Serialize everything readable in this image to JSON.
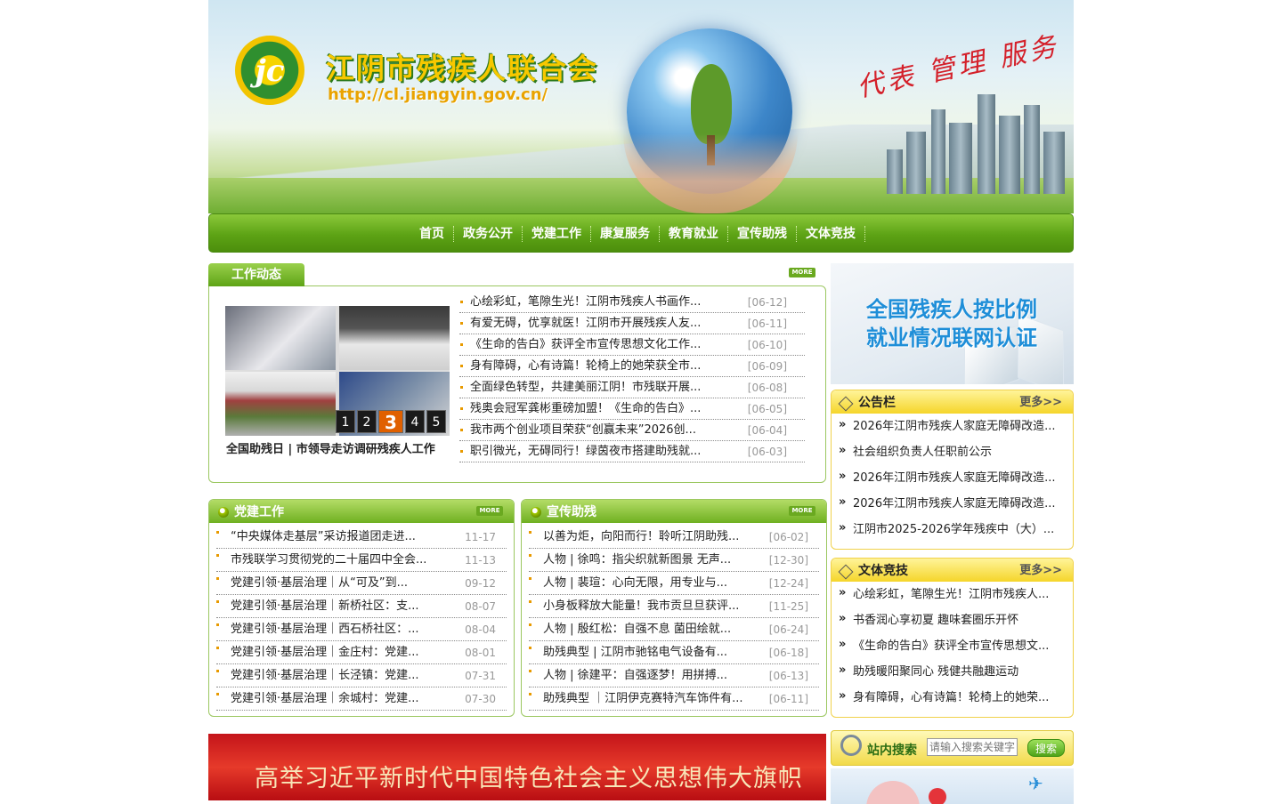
{
  "header": {
    "logo_text": "jc",
    "site_title": "江阴市残疾人联合会",
    "site_url": "http://cl.jiangyin.gov.cn/",
    "slogan": "代表 管理 服务"
  },
  "nav": {
    "items": [
      "首页",
      "政务公开",
      "党建工作",
      "康复服务",
      "教育就业",
      "宣传助残",
      "文体竞技"
    ]
  },
  "work": {
    "title": "工作动态",
    "more_label": "MORE",
    "photo_caption": "全国助残日 | 市领导走访调研残疾人工作",
    "pager": [
      "1",
      "2",
      "3",
      "4",
      "5"
    ],
    "pager_active": "3",
    "news": [
      {
        "title": "心绘彩虹，笔隙生光！江阴市残疾人书画作...",
        "date": "[06-12]"
      },
      {
        "title": "有爱无碍，优享就医！江阴市开展残疾人友...",
        "date": "[06-11]"
      },
      {
        "title": "《生命的告白》获评全市宣传思想文化工作...",
        "date": "[06-10]"
      },
      {
        "title": "身有障碍，心有诗篇！轮椅上的她荣获全市...",
        "date": "[06-09]"
      },
      {
        "title": "全面绿色转型，共建美丽江阴！市残联开展...",
        "date": "[06-08]"
      },
      {
        "title": "残奥会冠军龚彬重磅加盟！《生命的告白》...",
        "date": "[06-05]"
      },
      {
        "title": "我市两个创业项目荣获“创赢未来”2026创...",
        "date": "[06-04]"
      },
      {
        "title": "职引微光，无碍同行！绿茵夜市搭建助残就...",
        "date": "[06-03]"
      }
    ]
  },
  "party": {
    "title": "党建工作",
    "more_label": "MORE",
    "items": [
      {
        "title": "“中央媒体走基层”采访报道团走进...",
        "date": "11-17"
      },
      {
        "title": "市残联学习贯彻党的二十届四中全会...",
        "date": "11-13"
      },
      {
        "title": "党建引领·基层治理｜从“可及”到...",
        "date": "09-12"
      },
      {
        "title": "党建引领·基层治理｜新桥社区：支...",
        "date": "08-07"
      },
      {
        "title": "党建引领·基层治理｜西石桥社区：...",
        "date": "08-04"
      },
      {
        "title": "党建引领·基层治理｜金庄村：党建...",
        "date": "08-01"
      },
      {
        "title": "党建引领·基层治理｜长泾镇：党建...",
        "date": "07-31"
      },
      {
        "title": "党建引领·基层治理｜余城村：党建...",
        "date": "07-30"
      }
    ]
  },
  "publicity": {
    "title": "宣传助残",
    "more_label": "MORE",
    "items": [
      {
        "title": "以善为炬，向阳而行！聆听江阴助残...",
        "date": "[06-02]"
      },
      {
        "title": "人物 | 徐鸣：指尖织就新图景 无声...",
        "date": "[12-30]"
      },
      {
        "title": "人物 | 裴瑄：心向无限，用专业与...",
        "date": "[12-24]"
      },
      {
        "title": "小身板释放大能量！我市贡旦旦获评...",
        "date": "[11-25]"
      },
      {
        "title": "人物 | 殷红松：自强不息 菌田绘就...",
        "date": "[06-24]"
      },
      {
        "title": "助残典型 | 江阴市驰铭电气设备有...",
        "date": "[06-18]"
      },
      {
        "title": "人物 | 徐建平：自强逐梦！用拼搏...",
        "date": "[06-13]"
      },
      {
        "title": "助残典型 ｜江阴伊克赛特汽车饰件有...",
        "date": "[06-11]"
      }
    ]
  },
  "promo": {
    "line1": "全国残疾人按比例",
    "line2": "就业情况联网认证"
  },
  "notice": {
    "title": "公告栏",
    "more_label": "更多>>",
    "items": [
      "2026年江阴市残疾人家庭无障碍改造...",
      "社会组织负责人任职前公示",
      "2026年江阴市残疾人家庭无障碍改造...",
      "2026年江阴市残疾人家庭无障碍改造...",
      "江阴市2025-2026学年残疾中（大）..."
    ]
  },
  "sports": {
    "title": "文体竞技",
    "more_label": "更多>>",
    "items": [
      "心绘彩虹，笔隙生光！江阴市残疾人...",
      "书香润心享初夏 趣味套圈乐开怀",
      "《生命的告白》获评全市宣传思想文...",
      "助残暖阳聚同心 残健共融趣运动",
      "身有障碍，心有诗篇！轮椅上的她荣..."
    ]
  },
  "search": {
    "label": "站内搜索",
    "placeholder": "请输入搜索关键字",
    "button": "搜索"
  },
  "red_banner": {
    "text": "高举习近平新时代中国特色社会主义思想伟大旗帜"
  }
}
